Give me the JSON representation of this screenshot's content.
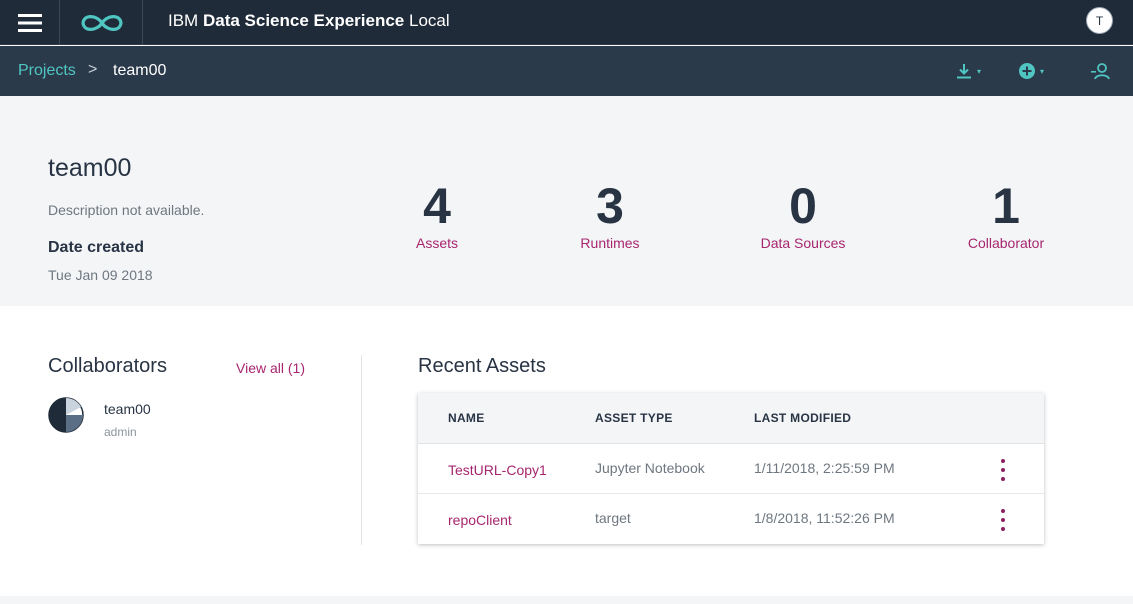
{
  "header": {
    "app_title_prefix": "IBM",
    "app_title_strong": "Data Science Experience",
    "app_title_suffix": "Local",
    "user_initial": "T"
  },
  "breadcrumb": {
    "parent": "Projects",
    "separator": ">",
    "current": "team00"
  },
  "toolbar_icons": [
    "download-icon",
    "add-circle-icon",
    "add-collaborator-icon"
  ],
  "project": {
    "name": "team00",
    "description": "Description not available.",
    "date_label": "Date created",
    "date_value": "Tue Jan 09 2018"
  },
  "stats": [
    {
      "value": "4",
      "label": "Assets"
    },
    {
      "value": "3",
      "label": "Runtimes"
    },
    {
      "value": "0",
      "label": "Data Sources"
    },
    {
      "value": "1",
      "label": "Collaborator"
    }
  ],
  "collaborators": {
    "title": "Collaborators",
    "view_all": "View all (1)",
    "items": [
      {
        "name": "team00",
        "role": "admin"
      }
    ]
  },
  "recent_assets": {
    "title": "Recent Assets",
    "columns": [
      "NAME",
      "ASSET TYPE",
      "LAST MODIFIED"
    ],
    "rows": [
      {
        "name": "TestURL-Copy1",
        "type": "Jupyter Notebook",
        "modified": "1/11/2018, 2:25:59 PM"
      },
      {
        "name": "repoClient",
        "type": "target",
        "modified": "1/8/2018, 11:52:26 PM"
      }
    ]
  },
  "colors": {
    "header_bg": "#1f2b38",
    "subbar_bg": "#2b3a4a",
    "accent_teal": "#4fc6c1",
    "accent_magenta": "#a6266e"
  }
}
